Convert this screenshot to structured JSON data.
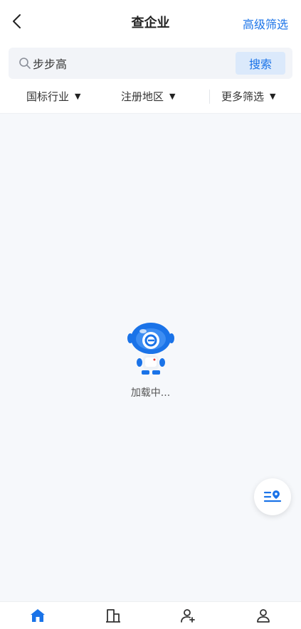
{
  "header": {
    "title": "查企业",
    "advanced_filter_label": "高级筛选",
    "back_icon": "chevron-left-icon"
  },
  "search": {
    "value": "步步高",
    "button_label": "搜索",
    "icon": "search-icon"
  },
  "filters": [
    {
      "label": "国标行业"
    },
    {
      "label": "注册地区"
    },
    {
      "label": "更多筛选"
    }
  ],
  "loading": {
    "text": "加载中..."
  },
  "fab": {
    "icon": "list-location-icon"
  },
  "tabbar": [
    {
      "icon": "home-icon",
      "active": true
    },
    {
      "icon": "building-icon",
      "active": false
    },
    {
      "icon": "add-user-icon",
      "active": false
    },
    {
      "icon": "user-icon",
      "active": false
    }
  ],
  "colors": {
    "accent": "#1a73e8",
    "background": "#f6f8fb"
  }
}
